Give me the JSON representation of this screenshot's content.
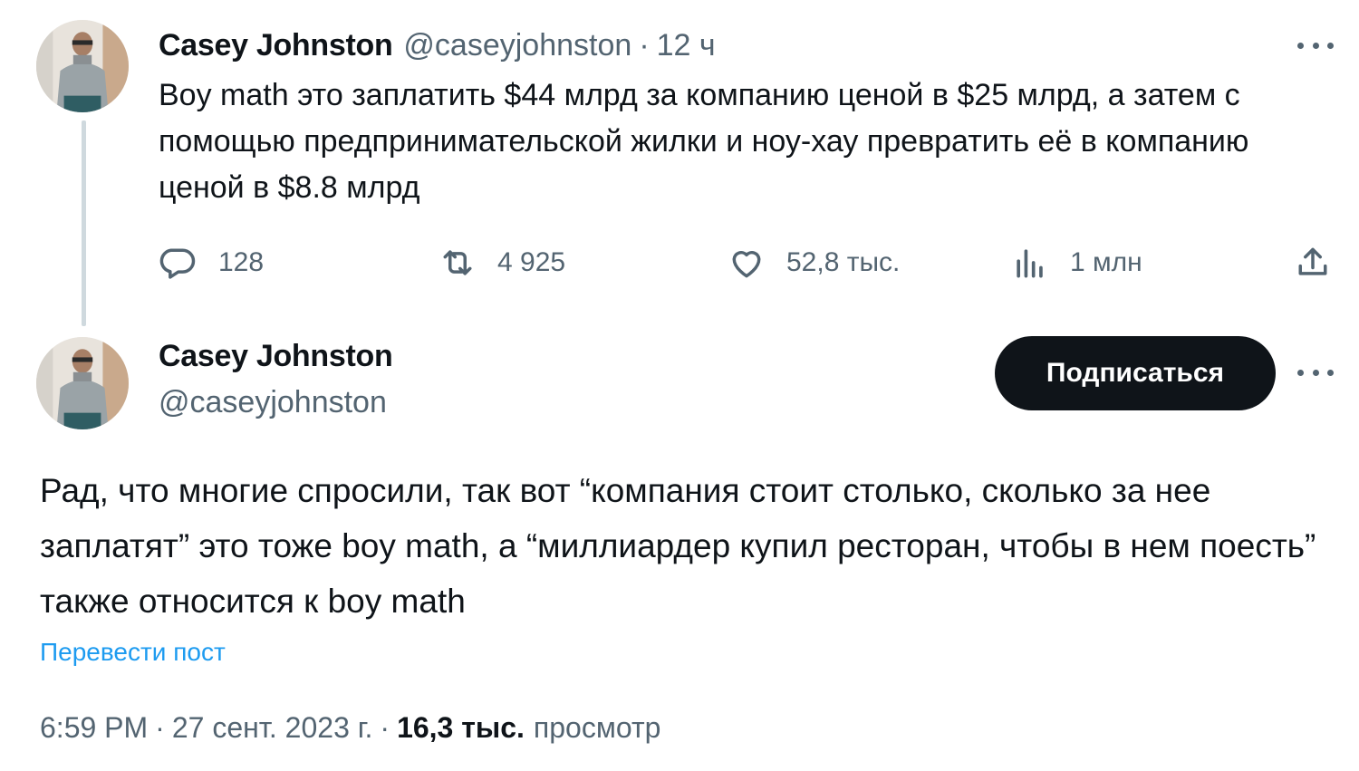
{
  "tweet1": {
    "author_name": "Casey Johnston",
    "handle": "@caseyjohnston",
    "separator": "·",
    "time": "12 ч",
    "text": "Boy math это заплатить $44 млрд за компанию ценой в $25 млрд, а затем с помощью предпринимательской жилки и ноу-хау превратить её в компанию ценой в $8.8 млрд",
    "actions": {
      "replies": "128",
      "reposts": "4 925",
      "likes": "52,8 тыс.",
      "views": "1 млн"
    }
  },
  "tweet2": {
    "author_name": "Casey Johnston",
    "handle": "@caseyjohnston",
    "follow_label": "Подписаться",
    "text": "Рад, что многие спросили, так вот “компания стоит столько, сколько за нее заплатят” это тоже boy math, а “миллиардер купил ресторан, чтобы в нем поесть” также относится к boy math",
    "translate_label": "Перевести пост",
    "time": "6:59 PM",
    "separator": "·",
    "date": "27 сент. 2023 г.",
    "views_count": "16,3 тыс.",
    "views_label": "просмотр"
  },
  "icons": {
    "more": "more-horizontal-icon",
    "reply": "reply-icon",
    "repost": "repost-icon",
    "like": "heart-icon",
    "views": "views-icon",
    "share": "share-icon"
  },
  "colors": {
    "text": "#0f1419",
    "secondary": "#536471",
    "link": "#1d9bf0",
    "button_bg": "#0f1419",
    "thread_line": "#cfd9de"
  }
}
